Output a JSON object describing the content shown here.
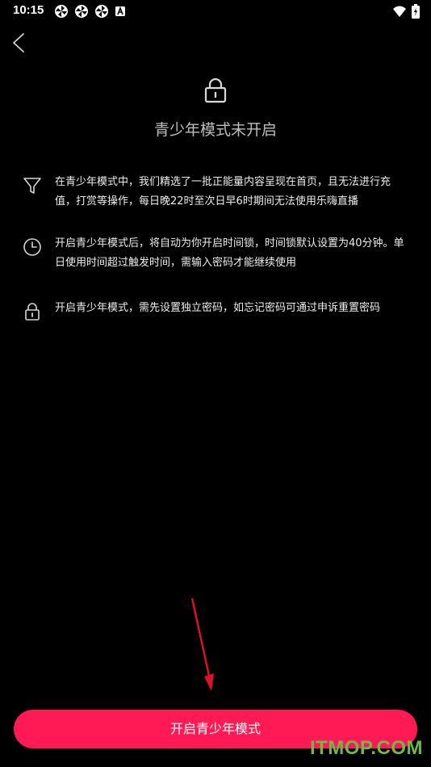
{
  "status_bar": {
    "time": "10:15",
    "notification_icons": [
      "pinwheel-app-icon",
      "pinwheel-app-icon",
      "pinwheel-app-icon",
      "a-badge-icon"
    ],
    "system_icons": [
      "wifi-icon",
      "battery-charging-icon"
    ]
  },
  "nav": {
    "back_icon": "chevron-left-icon"
  },
  "header": {
    "icon": "lock-icon",
    "title": "青少年模式未开启"
  },
  "info_items": [
    {
      "icon": "filter-icon",
      "text": "在青少年模式中，我们精选了一批正能量内容呈现在首页，且无法进行充值，打赏等操作，每日晚22时至次日早6时期间无法使用乐嗨直播"
    },
    {
      "icon": "clock-icon",
      "text": "开启青少年模式后，将自动为你开启时间锁，时间锁默认设置为40分钟。单日使用时间超过触发时间，需输入密码才能继续使用"
    },
    {
      "icon": "lock-icon",
      "text": "开启青少年模式，需先设置独立密码，如忘记密码可通过申诉重置密码"
    }
  ],
  "primary_button": {
    "label": "开启青少年模式"
  },
  "watermark": "ITMOP.COM",
  "colors": {
    "background": "#000000",
    "accent": "#ff1a55",
    "annotation_arrow": "#e0102a",
    "watermark": "#6fb84a"
  }
}
